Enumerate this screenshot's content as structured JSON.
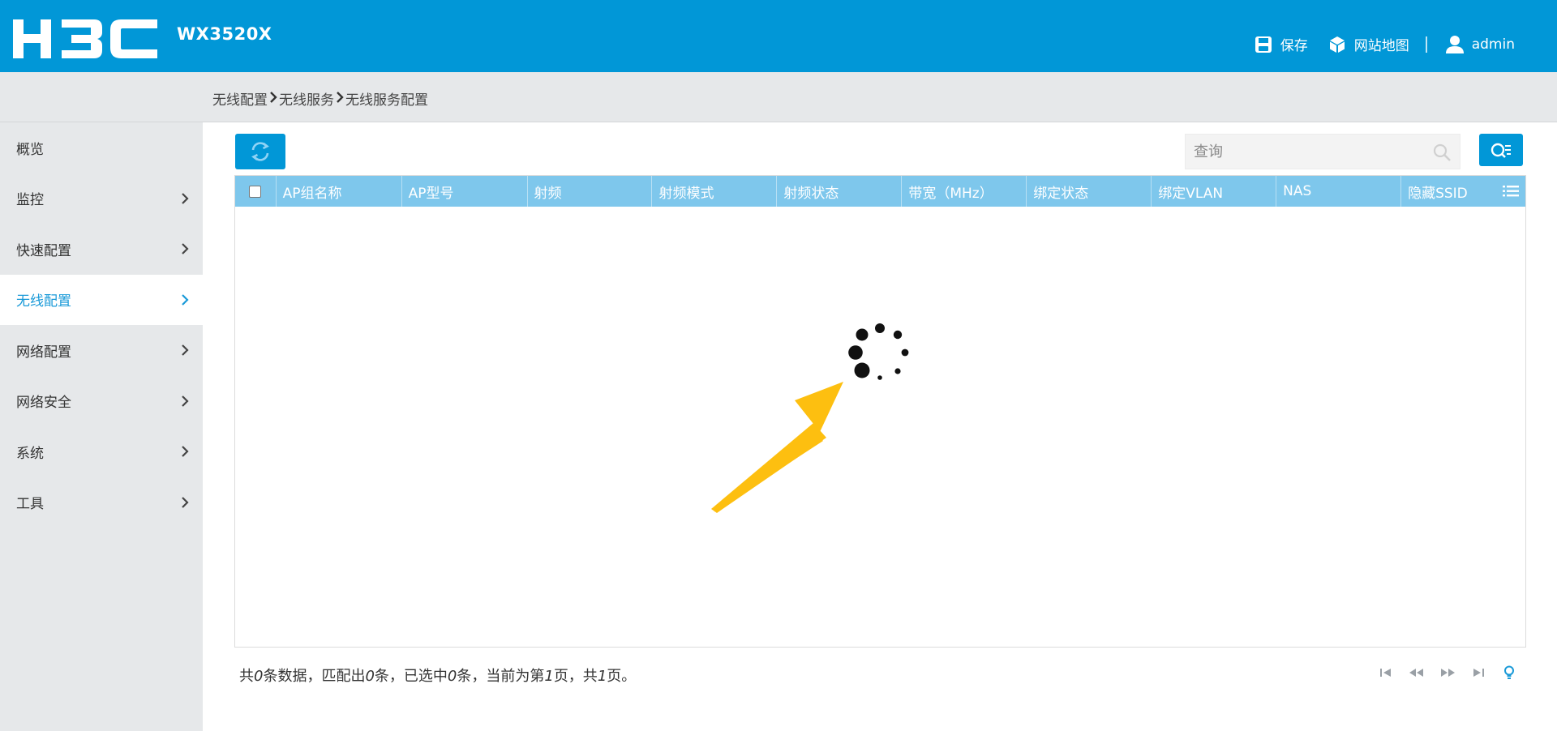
{
  "header": {
    "logo_text": "H3C",
    "model": "WX3520X",
    "save_label": "保存",
    "sitemap_label": "网站地图",
    "user_label": "admin",
    "background_color": "#0197d7"
  },
  "breadcrumb": {
    "items": [
      "无线配置",
      "无线服务",
      "无线服务配置"
    ]
  },
  "sidebar": {
    "items": [
      {
        "label": "概览",
        "has_arrow": false,
        "active": false
      },
      {
        "label": "监控",
        "has_arrow": true,
        "active": false
      },
      {
        "label": "快速配置",
        "has_arrow": true,
        "active": false
      },
      {
        "label": "无线配置",
        "has_arrow": true,
        "active": true
      },
      {
        "label": "网络配置",
        "has_arrow": true,
        "active": false
      },
      {
        "label": "网络安全",
        "has_arrow": true,
        "active": false
      },
      {
        "label": "系统",
        "has_arrow": true,
        "active": false
      },
      {
        "label": "工具",
        "has_arrow": true,
        "active": false
      }
    ],
    "active_color": "#1a9ad8"
  },
  "toolbar": {
    "refresh_icon": "refresh-icon",
    "search_placeholder": "查询",
    "advanced_search_icon": "advanced-search-icon"
  },
  "table": {
    "columns": [
      "AP组名称",
      "AP型号",
      "射频",
      "射频模式",
      "射频状态",
      "带宽（MHz）",
      "绑定状态",
      "绑定VLAN",
      "NAS",
      "隐藏SSID"
    ],
    "rows": [],
    "header_color": "#7ec7ec",
    "loading": true
  },
  "footer": {
    "status": {
      "p1": "共",
      "total": "0",
      "p2": "条数据，匹配出",
      "matched": "0",
      "p3": "条，已选中",
      "selected": "0",
      "p4": "条，当前为第",
      "current_page": "1",
      "p5": "页，共",
      "total_pages": "1",
      "p6": "页。"
    }
  },
  "annotation": {
    "arrow_color": "#fdbf10"
  }
}
